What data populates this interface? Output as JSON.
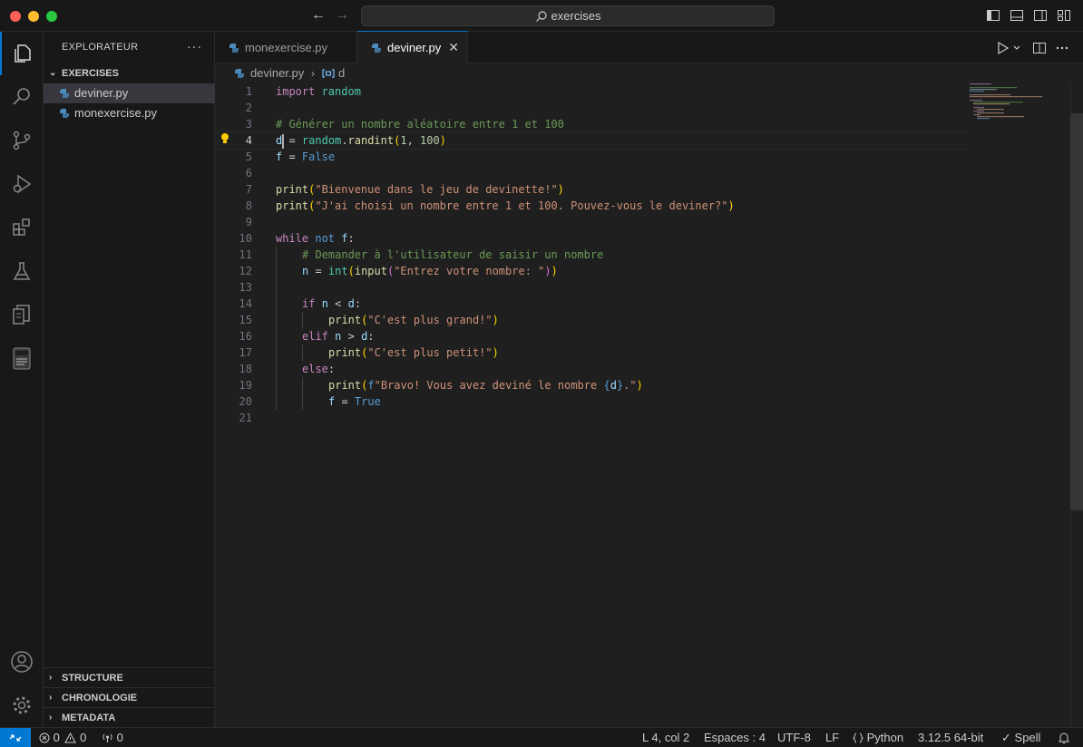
{
  "titlebar": {
    "search_text": "exercises"
  },
  "activity_bar": {
    "items": [
      "explorer-icon",
      "search-icon",
      "source-control-icon",
      "run-debug-icon",
      "extensions-icon",
      "testing-icon",
      "remote-explorer-icon",
      "notebook-icon"
    ],
    "bottom": [
      "account-icon",
      "manage-gear-icon"
    ]
  },
  "sidebar": {
    "title": "EXPLORATEUR",
    "more": "···",
    "folder": {
      "label": "EXERCISES",
      "files": [
        "deviner.py",
        "monexercise.py"
      ],
      "selected": "deviner.py"
    },
    "sections": [
      "STRUCTURE",
      "CHRONOLOGIE",
      "METADATA"
    ]
  },
  "tabs": [
    {
      "label": "monexercise.py",
      "active": false
    },
    {
      "label": "deviner.py",
      "active": true,
      "close": "✕"
    }
  ],
  "breadcrumb": {
    "file": "deviner.py",
    "separator": "›",
    "symbol": "d"
  },
  "editor": {
    "line_numbers": [
      "1",
      "2",
      "3",
      "4",
      "5",
      "6",
      "7",
      "8",
      "9",
      "10",
      "11",
      "12",
      "13",
      "14",
      "15",
      "16",
      "17",
      "18",
      "19",
      "20",
      "21"
    ],
    "current_line": 4,
    "code": {
      "l1_a": "import",
      "l1_b": " random",
      "l3": "# Générer un nombre aléatoire entre 1 et 100",
      "l4_a": "d",
      "l4_b": " = ",
      "l4_c": "random",
      "l4_d": ".",
      "l4_e": "randint",
      "l4_f": "(",
      "l4_g": "1",
      "l4_h": ", ",
      "l4_i": "100",
      "l4_j": ")",
      "l5_a": "f",
      "l5_b": " = ",
      "l5_c": "False",
      "l7_a": "print",
      "l7_b": "(",
      "l7_c": "\"Bienvenue dans le jeu de devinette!\"",
      "l7_d": ")",
      "l8_a": "print",
      "l8_b": "(",
      "l8_c": "\"J'ai choisi un nombre entre 1 et 100. Pouvez-vous le deviner?\"",
      "l8_d": ")",
      "l10_a": "while",
      "l10_b": " ",
      "l10_c": "not",
      "l10_d": " ",
      "l10_e": "f",
      "l10_f": ":",
      "l11": "# Demander à l'utilisateur de saisir un nombre",
      "l12_a": "n",
      "l12_b": " = ",
      "l12_c": "int",
      "l12_d": "(",
      "l12_e": "input",
      "l12_f": "(",
      "l12_g": "\"Entrez votre nombre: \"",
      "l12_h": ")",
      "l12_i": ")",
      "l14_a": "if",
      "l14_b": " ",
      "l14_c": "n",
      "l14_d": " < ",
      "l14_e": "d",
      "l14_f": ":",
      "l15_a": "print",
      "l15_b": "(",
      "l15_c": "\"C'est plus grand!\"",
      "l15_d": ")",
      "l16_a": "elif",
      "l16_b": " ",
      "l16_c": "n",
      "l16_d": " > ",
      "l16_e": "d",
      "l16_f": ":",
      "l17_a": "print",
      "l17_b": "(",
      "l17_c": "\"C'est plus petit!\"",
      "l17_d": ")",
      "l18_a": "else",
      "l18_b": ":",
      "l19_a": "print",
      "l19_b": "(",
      "l19_c": "f",
      "l19_d": "\"Bravo! Vous avez deviné le nombre ",
      "l19_e": "{",
      "l19_f": "d",
      "l19_g": "}",
      "l19_h": ".\"",
      "l19_i": ")",
      "l20_a": "f",
      "l20_b": " = ",
      "l20_c": "True"
    }
  },
  "status_bar": {
    "errors": "0",
    "warnings": "0",
    "ports": "0",
    "position": "L 4, col 2",
    "indent": "Espaces : 4",
    "encoding": "UTF-8",
    "eol": "LF",
    "language": "Python",
    "interpreter": "3.12.5 64-bit",
    "spell": "Spell"
  },
  "colors": {
    "accent": "#0078d4",
    "keyword": "#c586c0",
    "function": "#dcdcaa",
    "string": "#ce9178",
    "comment": "#6a9955",
    "variable": "#9cdcfe"
  }
}
